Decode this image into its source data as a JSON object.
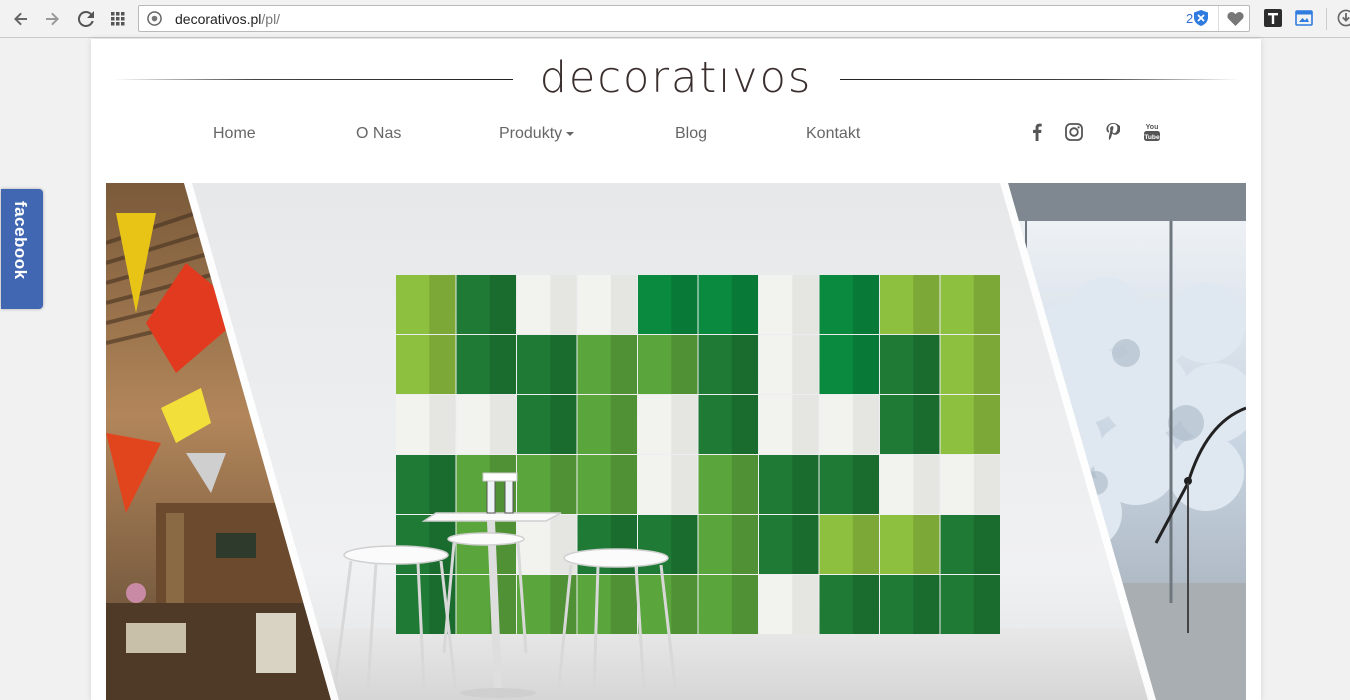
{
  "browser": {
    "url_host": "decorativos.pl",
    "url_path": "/pl/",
    "extension_count": "2",
    "icons": [
      "back-icon",
      "forward-icon",
      "reload-icon",
      "apps-icon",
      "site-info-icon",
      "extension-badge-icon",
      "heart-icon",
      "t-extension-icon",
      "screenshot-extension-icon",
      "download-icon"
    ]
  },
  "site": {
    "logo": "decoratıvos",
    "menu": {
      "home": "Home",
      "about": "O Nas",
      "products": "Produkty",
      "blog": "Blog",
      "contact": "Kontakt"
    },
    "social": [
      "facebook-icon",
      "instagram-icon",
      "pinterest-icon",
      "youtube-icon"
    ],
    "youtube_glyph_text": "You\nTube"
  },
  "hero": {
    "wall_colors": [
      "#1e7a35",
      "#0a8a3f",
      "#5aa63c",
      "#8ec03f",
      "#f2f2ef"
    ]
  },
  "sidebar": {
    "facebook_tab": "facebook"
  },
  "colors": {
    "accent_blue": "#4267b2",
    "logo_color": "#3a2f2e",
    "menu_text": "#666666"
  }
}
